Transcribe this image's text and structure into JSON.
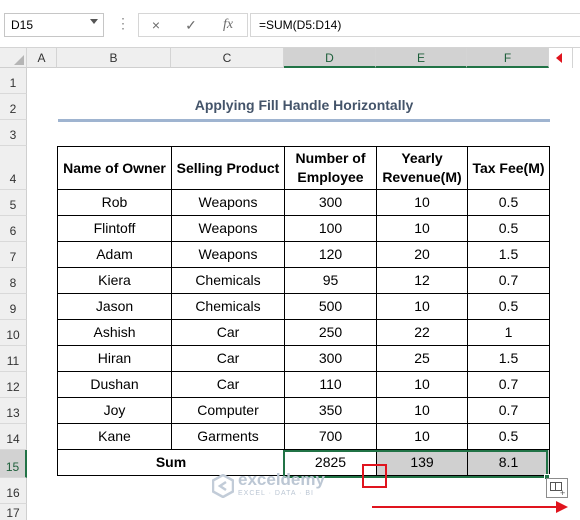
{
  "name_box": "D15",
  "formula_bar": {
    "cancel_icon": "×",
    "enter_icon": "✓",
    "fx_label": "fx",
    "formula": "=SUM(D5:D14)"
  },
  "columns": [
    "A",
    "B",
    "C",
    "D",
    "E",
    "F"
  ],
  "rows": [
    "1",
    "2",
    "3",
    "4",
    "5",
    "6",
    "7",
    "8",
    "9",
    "10",
    "11",
    "12",
    "13",
    "14",
    "15",
    "16",
    "17"
  ],
  "sheet": {
    "title": "Applying Fill Handle Horizontally",
    "headers": [
      "Name of Owner",
      "Selling Product",
      "Number of Employee",
      "Yearly Revenue(M)",
      "Tax Fee(M)"
    ],
    "data": [
      [
        "Rob",
        "Weapons",
        "300",
        "10",
        "0.5"
      ],
      [
        "Flintoff",
        "Weapons",
        "100",
        "10",
        "0.5"
      ],
      [
        "Adam",
        "Weapons",
        "120",
        "20",
        "1.5"
      ],
      [
        "Kiera",
        "Chemicals",
        "95",
        "12",
        "0.7"
      ],
      [
        "Jason",
        "Chemicals",
        "500",
        "10",
        "0.5"
      ],
      [
        "Ashish",
        "Car",
        "250",
        "22",
        "1"
      ],
      [
        "Hiran",
        "Car",
        "300",
        "25",
        "1.5"
      ],
      [
        "Dushan",
        "Car",
        "110",
        "10",
        "0.7"
      ],
      [
        "Joy",
        "Computer",
        "350",
        "10",
        "0.7"
      ],
      [
        "Kane",
        "Garments",
        "700",
        "10",
        "0.5"
      ]
    ],
    "sum_label": "Sum",
    "sums": [
      "2825",
      "139",
      "8.1"
    ]
  },
  "watermark": {
    "name": "exceldemy",
    "tagline": "EXCEL · DATA · BI"
  },
  "colors": {
    "accent": "#217346",
    "highlight": "#e0141e",
    "title": "#44546a"
  }
}
